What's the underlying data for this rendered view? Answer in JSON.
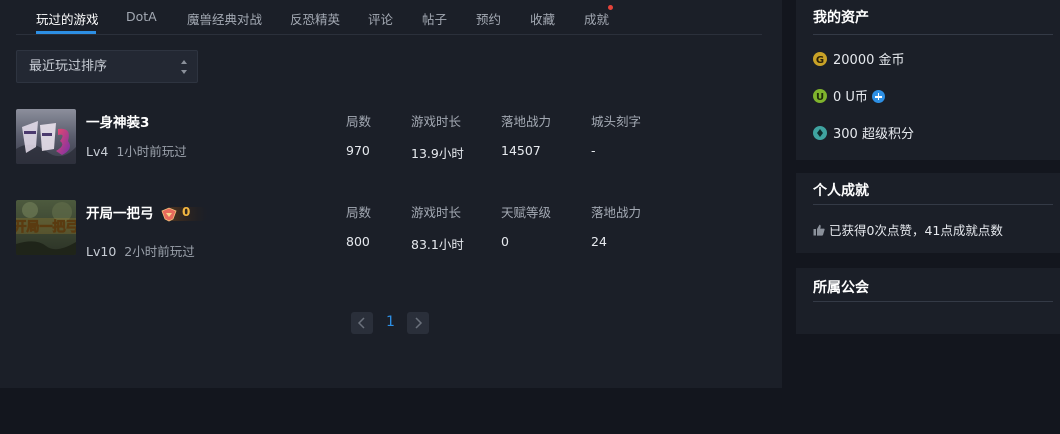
{
  "tabs": [
    {
      "label": "玩过的游戏",
      "active": true
    },
    {
      "label": "DotA"
    },
    {
      "label": "魔兽经典对战"
    },
    {
      "label": "反恐精英"
    },
    {
      "label": "评论"
    },
    {
      "label": "帖子"
    },
    {
      "label": "预约"
    },
    {
      "label": "收藏"
    },
    {
      "label": "成就",
      "has_notification_dot": true
    }
  ],
  "sort": {
    "selected": "最近玩过排序"
  },
  "games": [
    {
      "name": "一身神装3",
      "level": "Lv4",
      "last_played": "1小时前玩过",
      "stats": [
        {
          "label": "局数",
          "value": "970"
        },
        {
          "label": "游戏时长",
          "value": "13.9小时"
        },
        {
          "label": "落地战力",
          "value": "14507"
        },
        {
          "label": "城头刻字",
          "value": "-"
        }
      ]
    },
    {
      "name": "开局一把弓",
      "badge_count": "0",
      "level": "Lv10",
      "last_played": "2小时前玩过",
      "stats": [
        {
          "label": "局数",
          "value": "800"
        },
        {
          "label": "游戏时长",
          "value": "83.1小时"
        },
        {
          "label": "天赋等级",
          "value": "0"
        },
        {
          "label": "落地战力",
          "value": "24"
        }
      ]
    }
  ],
  "pagination": {
    "current": "1"
  },
  "assets": {
    "title": "我的资产",
    "gold": {
      "icon": "gold-coin-icon",
      "text": "20000 金币"
    },
    "ucoin": {
      "icon": "u-coin-icon",
      "text": "0 U币"
    },
    "points": {
      "icon": "super-points-icon",
      "text": "300 超级积分"
    }
  },
  "achievements": {
    "title": "个人成就",
    "text": "已获得0次点赞，41点成就点数"
  },
  "guild": {
    "title": "所属公会"
  },
  "colors": {
    "accent": "#2d8fe4",
    "background": "#13161e",
    "panel": "#1b1f28",
    "notification": "#e5433a"
  }
}
